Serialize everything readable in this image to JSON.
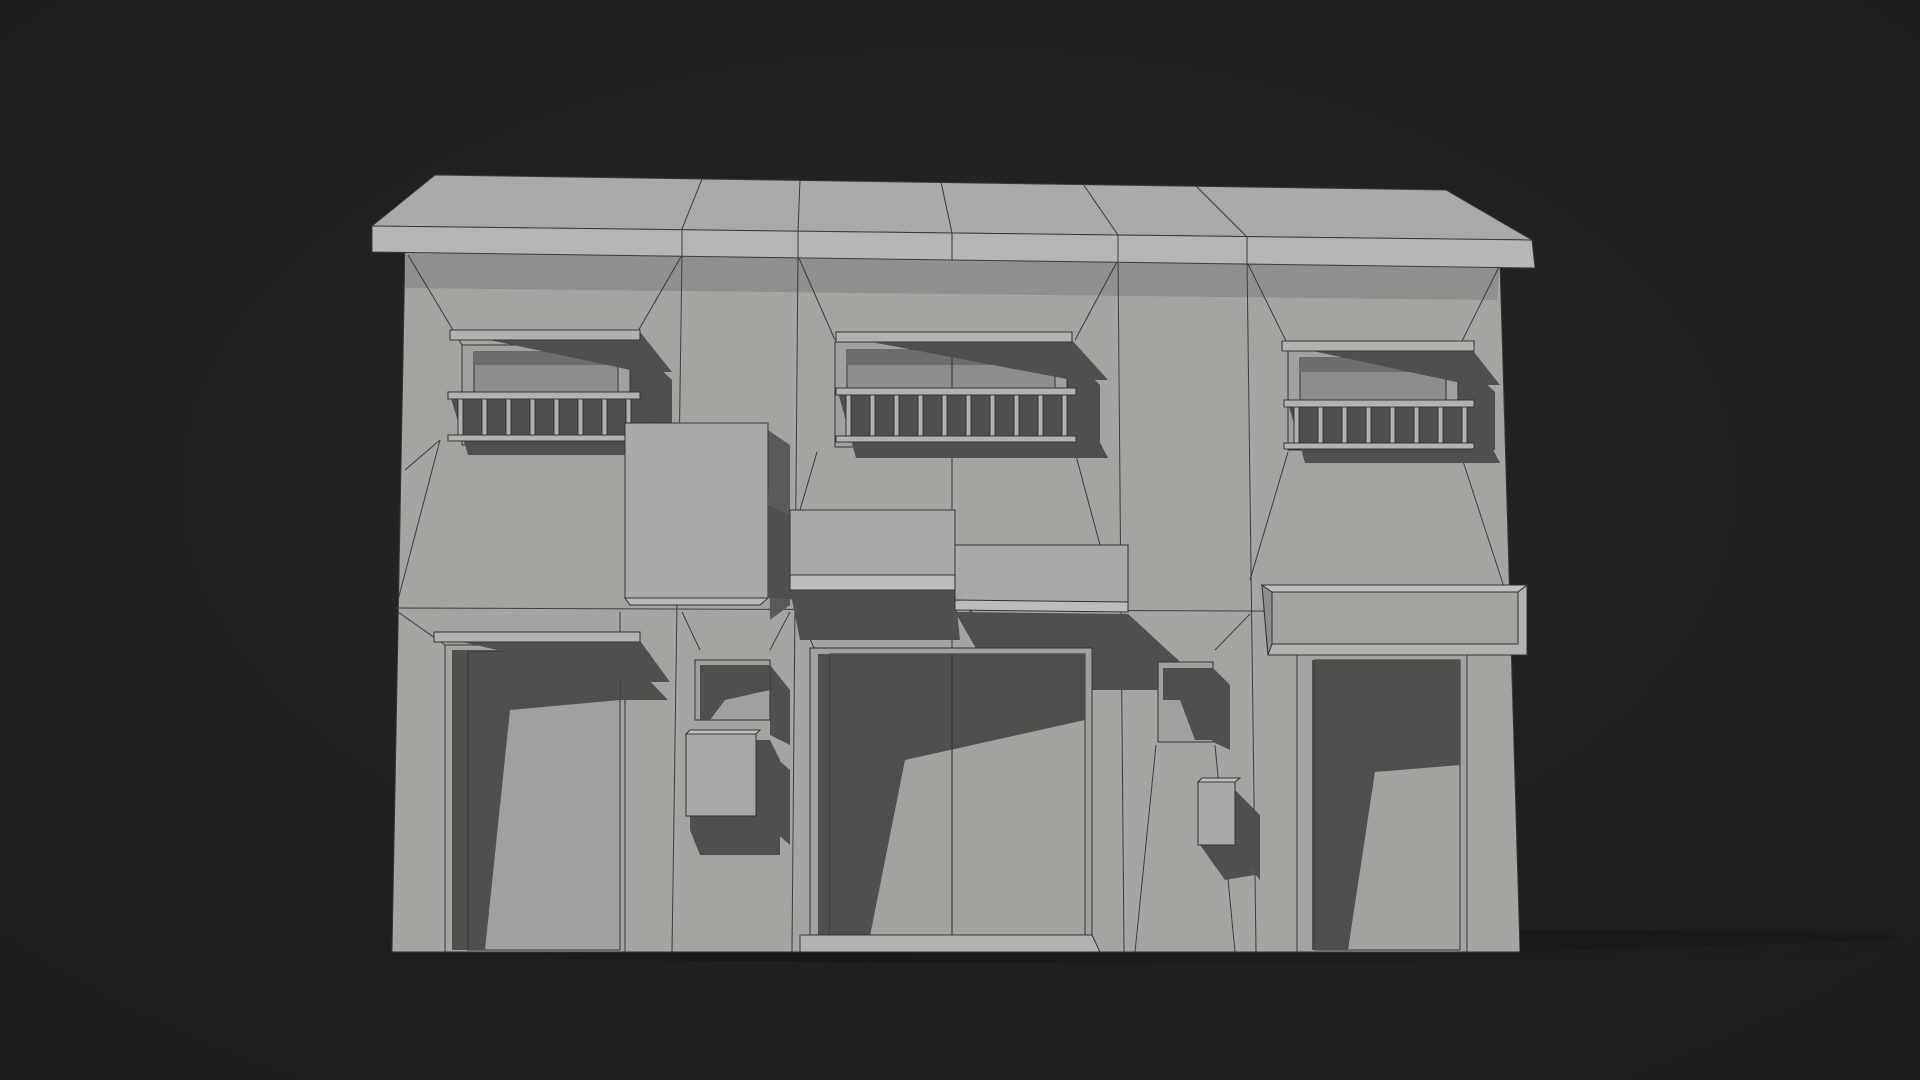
{
  "scene": {
    "subject": "building-facade-clay-render",
    "colors": {
      "background": "#232323",
      "wall": "#a3a4a0",
      "wall_light": "#acadaa",
      "roof_top": "#a9aaa7",
      "roof_front": "#b4b5b2",
      "shadow": "#4f504e",
      "recess": "#8d8e8b",
      "wire": "#333333",
      "ground_shadow": "#1a1a1a"
    }
  }
}
